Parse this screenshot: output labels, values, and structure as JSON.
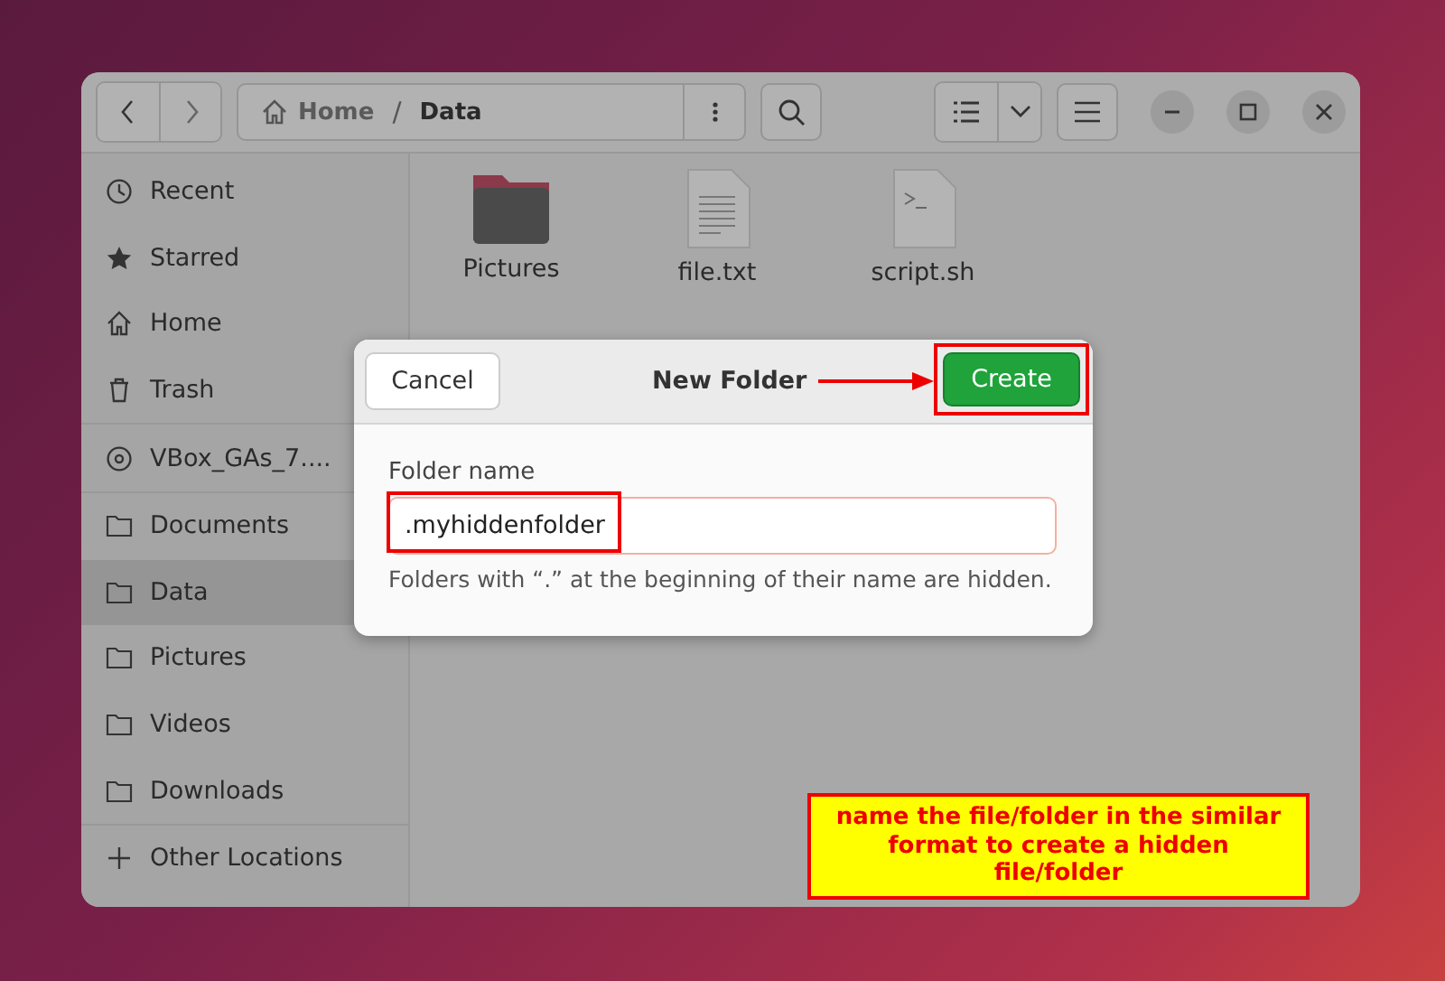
{
  "path": {
    "segments": [
      {
        "label": "Home",
        "kind": "home"
      },
      {
        "label": "Data",
        "kind": "folder"
      }
    ],
    "separator": "/"
  },
  "sidebar": {
    "sections": [
      {
        "items": [
          {
            "label": "Recent",
            "kind": "recent",
            "selected": false
          },
          {
            "label": "Starred",
            "kind": "star",
            "selected": false
          },
          {
            "label": "Home",
            "kind": "home",
            "selected": false
          },
          {
            "label": "Trash",
            "kind": "trash",
            "selected": false
          }
        ]
      },
      {
        "items": [
          {
            "label": "VBox_GAs_7....",
            "kind": "disc",
            "selected": false
          }
        ]
      },
      {
        "items": [
          {
            "label": "Documents",
            "kind": "folder",
            "selected": false
          },
          {
            "label": "Data",
            "kind": "folder",
            "selected": true
          },
          {
            "label": "Pictures",
            "kind": "folder",
            "selected": false
          },
          {
            "label": "Videos",
            "kind": "folder",
            "selected": false
          },
          {
            "label": "Downloads",
            "kind": "folder",
            "selected": false
          }
        ]
      },
      {
        "items": [
          {
            "label": "Other Locations",
            "kind": "plus",
            "selected": false
          }
        ]
      }
    ]
  },
  "files": [
    {
      "name": "Pictures",
      "kind": "folder"
    },
    {
      "name": "file.txt",
      "kind": "text"
    },
    {
      "name": "script.sh",
      "kind": "script"
    }
  ],
  "dialog": {
    "title": "New Folder",
    "cancel": "Cancel",
    "create": "Create",
    "field_label": "Folder name",
    "value": ".myhiddenfolder",
    "hint": "Folders with “.” at the beginning of their name are hidden."
  },
  "annotation": {
    "text": "name the file/folder in the similar format to create a hidden file/folder"
  }
}
